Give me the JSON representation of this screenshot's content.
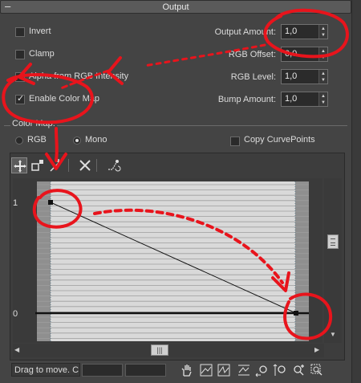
{
  "rollout": {
    "title": "Output",
    "collapse_glyph": "–"
  },
  "options": {
    "invert": {
      "label": "Invert",
      "checked": false
    },
    "clamp": {
      "label": "Clamp",
      "checked": false
    },
    "alpha_from_rgb": {
      "label": "Alpha from RGB Intensity",
      "checked": false
    },
    "enable_color_map": {
      "label": "Enable Color Map",
      "checked": true
    }
  },
  "spinners": {
    "output_amount": {
      "label": "Output Amount:",
      "value": "1,0"
    },
    "rgb_offset": {
      "label": "RGB Offset:",
      "value": "0,0"
    },
    "rgb_level": {
      "label": "RGB Level:",
      "value": "1,0"
    },
    "bump_amount": {
      "label": "Bump Amount:",
      "value": "1,0"
    }
  },
  "color_map": {
    "group_label": "Color Map:",
    "rgb_label": "RGB",
    "mono_label": "Mono",
    "mode": "Mono",
    "copy_curve_points": {
      "label": "Copy CurvePoints",
      "checked": false
    },
    "y_labels": [
      "1",
      "0"
    ],
    "curve_points": [
      {
        "x": 0.0,
        "y": 1.0
      },
      {
        "x": 1.0,
        "y": 0.0
      }
    ]
  },
  "toolbar_icons": [
    "move-icon",
    "scale-point-icon",
    "add-point-icon",
    "delete-point-icon",
    "reset-curves-icon"
  ],
  "status": {
    "text": "Drag to move. C"
  },
  "nav_icons": [
    "pan-icon",
    "zoom-extents-icon",
    "zoom-horizontal-extents-icon",
    "zoom-vertical-extents-icon",
    "zoom-horizontal-icon",
    "zoom-vertical-icon",
    "zoom-icon",
    "zoom-region-icon"
  ],
  "colors": {
    "annotation": "#e8141c",
    "panel": "#444444",
    "curve": "#111111"
  }
}
